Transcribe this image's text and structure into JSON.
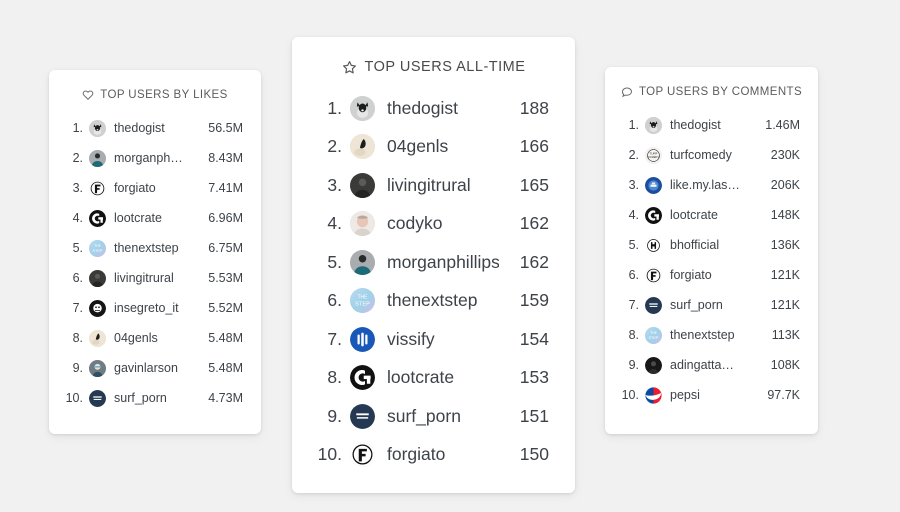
{
  "theme": {
    "background": "#f1f1f1",
    "card_background": "#ffffff",
    "text_color": "#3d4349",
    "header_color": "#5c5c5c"
  },
  "cards": {
    "likes": {
      "title": "TOP USERS BY LIKES",
      "icon": "heart-icon",
      "rows": [
        {
          "rank": "1.",
          "username": "thedogist",
          "value": "56.5M",
          "avatar": "dog-photo"
        },
        {
          "rank": "2.",
          "username": "morganph…",
          "value": "8.43M",
          "avatar": "person-teal-photo"
        },
        {
          "rank": "3.",
          "username": "forgiato",
          "value": "7.41M",
          "avatar": "forgiato-logo"
        },
        {
          "rank": "4.",
          "username": "lootcrate",
          "value": "6.96M",
          "avatar": "lootcrate-logo"
        },
        {
          "rank": "5.",
          "username": "thenextstep",
          "value": "6.75M",
          "avatar": "thenextstep-logo"
        },
        {
          "rank": "6.",
          "username": "livingitrural",
          "value": "5.53M",
          "avatar": "dark-portrait-photo"
        },
        {
          "rank": "7.",
          "username": "insegreto_it",
          "value": "5.52M",
          "avatar": "insegreto-logo"
        },
        {
          "rank": "8.",
          "username": "04genls",
          "value": "5.48M",
          "avatar": "04genls-photo"
        },
        {
          "rank": "9.",
          "username": "gavinlarson",
          "value": "5.48M",
          "avatar": "gavin-photo"
        },
        {
          "rank": "10.",
          "username": "surf_porn",
          "value": "4.73M",
          "avatar": "surfporn-logo"
        }
      ]
    },
    "alltime": {
      "title": "TOP USERS ALL-TIME",
      "icon": "star-icon",
      "rows": [
        {
          "rank": "1.",
          "username": "thedogist",
          "value": "188",
          "avatar": "dog-photo"
        },
        {
          "rank": "2.",
          "username": "04genls",
          "value": "166",
          "avatar": "04genls-photo"
        },
        {
          "rank": "3.",
          "username": "livingitrural",
          "value": "165",
          "avatar": "dark-portrait-photo"
        },
        {
          "rank": "4.",
          "username": "codyko",
          "value": "162",
          "avatar": "codyko-photo"
        },
        {
          "rank": "5.",
          "username": "morganphillips",
          "value": "162",
          "avatar": "person-teal-photo"
        },
        {
          "rank": "6.",
          "username": "thenextstep",
          "value": "159",
          "avatar": "thenextstep-logo"
        },
        {
          "rank": "7.",
          "username": "vissify",
          "value": "154",
          "avatar": "vissify-logo"
        },
        {
          "rank": "8.",
          "username": "lootcrate",
          "value": "153",
          "avatar": "lootcrate-logo"
        },
        {
          "rank": "9.",
          "username": "surf_porn",
          "value": "151",
          "avatar": "surfporn-logo"
        },
        {
          "rank": "10.",
          "username": "forgiato",
          "value": "150",
          "avatar": "forgiato-logo"
        }
      ]
    },
    "comments": {
      "title": "TOP USERS BY COMMENTS",
      "icon": "comment-icon",
      "rows": [
        {
          "rank": "1.",
          "username": "thedogist",
          "value": "1.46M",
          "avatar": "dog-photo"
        },
        {
          "rank": "2.",
          "username": "turfcomedy",
          "value": "230K",
          "avatar": "turfcomedy-logo"
        },
        {
          "rank": "3.",
          "username": "like.my.las…",
          "value": "206K",
          "avatar": "likemylast-logo"
        },
        {
          "rank": "4.",
          "username": "lootcrate",
          "value": "148K",
          "avatar": "lootcrate-logo"
        },
        {
          "rank": "5.",
          "username": "bhofficial",
          "value": "136K",
          "avatar": "bhofficial-logo"
        },
        {
          "rank": "6.",
          "username": "forgiato",
          "value": "121K",
          "avatar": "forgiato-logo"
        },
        {
          "rank": "7.",
          "username": "surf_porn",
          "value": "121K",
          "avatar": "surfporn-logo"
        },
        {
          "rank": "8.",
          "username": "thenextstep",
          "value": "113K",
          "avatar": "thenextstep-logo"
        },
        {
          "rank": "9.",
          "username": "adingatta…",
          "value": "108K",
          "avatar": "adingatta-photo"
        },
        {
          "rank": "10.",
          "username": "pepsi",
          "value": "97.7K",
          "avatar": "pepsi-logo"
        }
      ]
    }
  }
}
